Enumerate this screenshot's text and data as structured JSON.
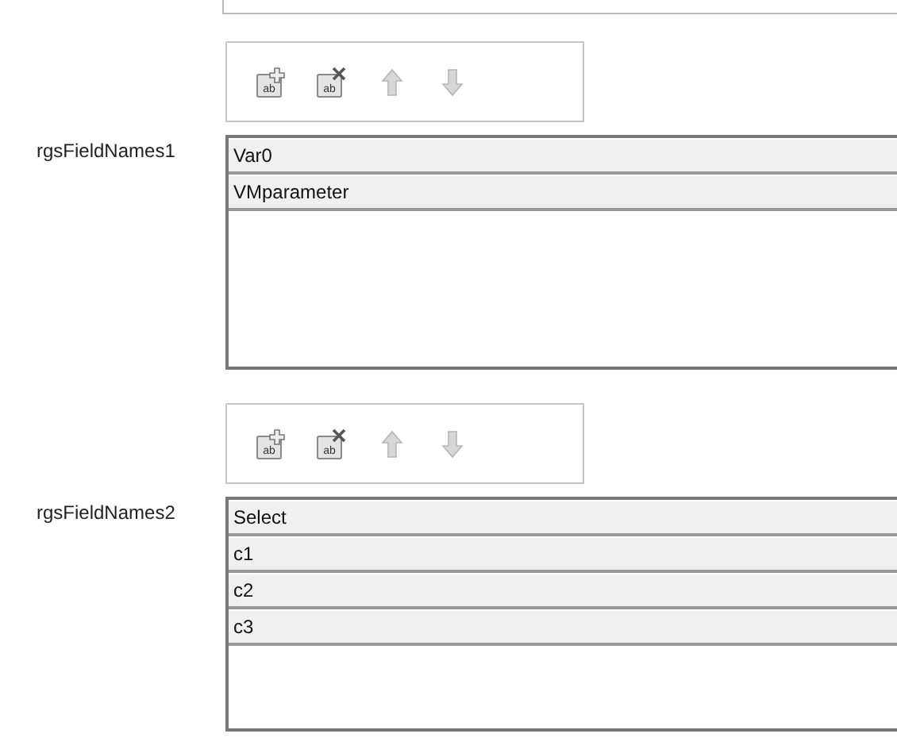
{
  "lists": [
    {
      "label": "rgsFieldNames1",
      "toolbar": [
        {
          "kind": "add",
          "icon_text": "ab",
          "disabled": false
        },
        {
          "kind": "remove",
          "icon_text": "ab",
          "disabled": false
        },
        {
          "kind": "up",
          "disabled": true
        },
        {
          "kind": "down",
          "disabled": true
        }
      ],
      "items": [
        "Var0",
        "VMparameter"
      ]
    },
    {
      "label": "rgsFieldNames2",
      "toolbar": [
        {
          "kind": "add",
          "icon_text": "ab",
          "disabled": false
        },
        {
          "kind": "remove",
          "icon_text": "ab",
          "disabled": false
        },
        {
          "kind": "up",
          "disabled": true
        },
        {
          "kind": "down",
          "disabled": true
        }
      ],
      "items": [
        "Select",
        "c1",
        "c2",
        "c3"
      ]
    }
  ]
}
